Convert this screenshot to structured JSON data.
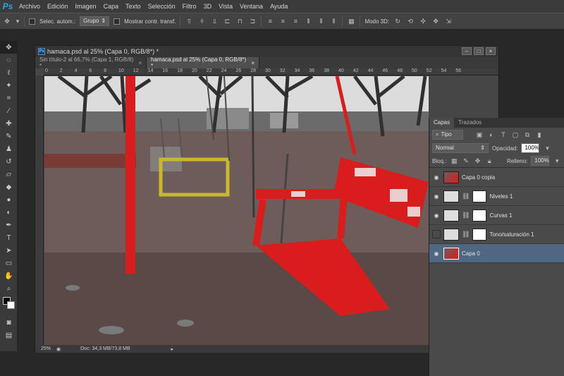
{
  "app": {
    "logo": "Ps"
  },
  "menu": [
    "Archivo",
    "Edición",
    "Imagen",
    "Capa",
    "Texto",
    "Selección",
    "Filtro",
    "3D",
    "Vista",
    "Ventana",
    "Ayuda"
  ],
  "options": {
    "auto_select_label": "Selec. autom.:",
    "group_value": "Grupo",
    "show_transform_label": "Mostrar contr. transf.",
    "mode3d_label": "Modo 3D:"
  },
  "document": {
    "title": "hamaca.psd al 25% (Capa 0, RGB/8*) *",
    "tabs": [
      {
        "label": "Sin título-2 al 66,7% (Capa 1, RGB/8) *",
        "close": "×"
      },
      {
        "label": "hamaca.psd al 25% (Capa 0, RGB/8*) *",
        "close": "×"
      }
    ],
    "ruler_ticks": [
      "0",
      "2",
      "4",
      "6",
      "8",
      "10",
      "12",
      "14",
      "16",
      "18",
      "20",
      "22",
      "24",
      "26",
      "28",
      "30",
      "32",
      "34",
      "36",
      "38",
      "40",
      "42",
      "44",
      "46",
      "48",
      "50",
      "52",
      "54",
      "56"
    ],
    "status": {
      "zoom": "25%",
      "doc": "Doc: 34,3 MB/73,8 MB"
    },
    "win_buttons": [
      "–",
      "□",
      "×"
    ]
  },
  "layers_panel": {
    "tabs": [
      "Capas",
      "Trazados"
    ],
    "filter": "Tipo",
    "blend_mode": "Normal",
    "opacity_label": "Opacidad:",
    "opacity_value": "100%",
    "lock_label": "Bloq.:",
    "fill_label": "Relleno:",
    "fill_value": "100%",
    "layers": [
      {
        "name": "Capa 0 copia",
        "visible": true,
        "selected": false
      },
      {
        "name": "Niveles 1",
        "visible": true,
        "selected": false
      },
      {
        "name": "Curvas 1",
        "visible": true,
        "selected": false
      },
      {
        "name": "Tono/saturación 1",
        "visible": false,
        "selected": false
      },
      {
        "name": "Capa 0",
        "visible": true,
        "selected": true
      }
    ]
  },
  "colors": {
    "accent": "#2fa3e6",
    "selection": "#4f6781",
    "swing_red": "#d91c1c"
  }
}
